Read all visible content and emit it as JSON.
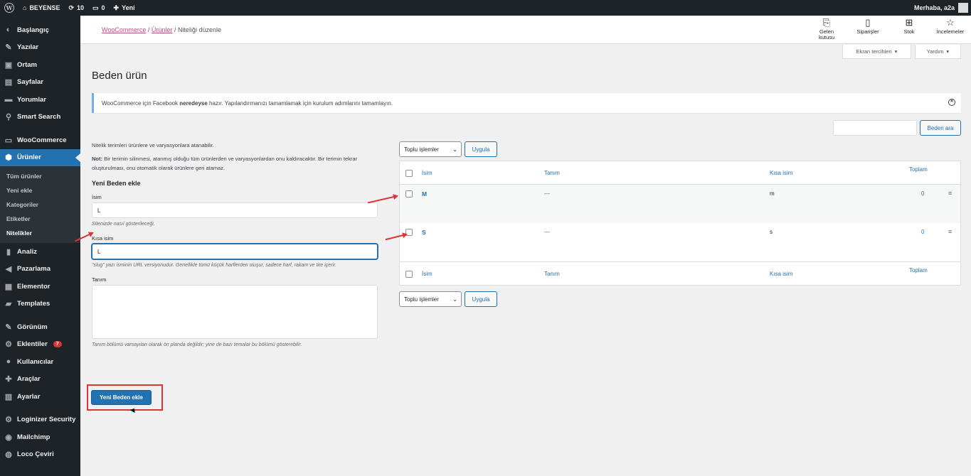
{
  "adminbar": {
    "site_name": "BEYENSE",
    "updates": "10",
    "comments": "0",
    "new_label": "Yeni",
    "greeting": "Merhaba, a2a"
  },
  "sidebar": {
    "items": [
      {
        "label": "Başlangıç",
        "icon": "dashboard-icon",
        "glyph": "◐"
      },
      {
        "label": "Yazılar",
        "icon": "pin-icon",
        "glyph": "✎"
      },
      {
        "label": "Ortam",
        "icon": "media-icon",
        "glyph": "▣"
      },
      {
        "label": "Sayfalar",
        "icon": "pages-icon",
        "glyph": "▤"
      },
      {
        "label": "Yorumlar",
        "icon": "comments-icon",
        "glyph": "▬"
      },
      {
        "label": "Smart Search",
        "icon": "search-icon",
        "glyph": "⚲"
      },
      {
        "label": "WooCommerce",
        "icon": "woocommerce-icon",
        "glyph": "▭"
      },
      {
        "label": "Ürünler",
        "icon": "products-icon",
        "glyph": "⬢"
      },
      {
        "label": "Analiz",
        "icon": "analytics-icon",
        "glyph": "▮"
      },
      {
        "label": "Pazarlama",
        "icon": "megaphone-icon",
        "glyph": "◀"
      },
      {
        "label": "Elementor",
        "icon": "elementor-icon",
        "glyph": "▦"
      },
      {
        "label": "Templates",
        "icon": "folder-icon",
        "glyph": "▰"
      },
      {
        "label": "Görünüm",
        "icon": "brush-icon",
        "glyph": "✎"
      },
      {
        "label": "Eklentiler",
        "icon": "plugin-icon",
        "glyph": "⚙",
        "badge": "7"
      },
      {
        "label": "Kullanıcılar",
        "icon": "users-icon",
        "glyph": "●"
      },
      {
        "label": "Araçlar",
        "icon": "tools-icon",
        "glyph": "✚"
      },
      {
        "label": "Ayarlar",
        "icon": "settings-icon",
        "glyph": "▥"
      },
      {
        "label": "Loginizer Security",
        "icon": "gear-icon",
        "glyph": "⚙"
      },
      {
        "label": "Mailchimp",
        "icon": "mailchimp-icon",
        "glyph": "◉"
      },
      {
        "label": "Loco Çeviri",
        "icon": "translate-icon",
        "glyph": "◍"
      }
    ],
    "submenu": [
      "Tüm ürünler",
      "Yeni ekle",
      "Kategoriler",
      "Etiketler",
      "Nitelikler"
    ]
  },
  "header": {
    "breadcrumb_1": "WooCommerce",
    "breadcrumb_2": "Ürünler",
    "breadcrumb_3": "Niteliği düzenle",
    "tools": [
      {
        "label": "Gelen kutusu",
        "icon": "inbox-icon",
        "glyph": "⎘"
      },
      {
        "label": "Siparişler",
        "icon": "orders-icon",
        "glyph": "▯"
      },
      {
        "label": "Stok",
        "icon": "stock-icon",
        "glyph": "⊞"
      },
      {
        "label": "İncelemeler",
        "icon": "star-icon",
        "glyph": "☆"
      }
    ],
    "screen_options": "Ekran tercihleri",
    "help": "Yardım"
  },
  "page": {
    "title": "Beden ürün",
    "notice_pre": "WooCommerce için Facebook ",
    "notice_bold": "neredeyse",
    "notice_post": " hazır. Yapılandırmanızı tamamlamak için kurulum adımlarını tamamlayın."
  },
  "search": {
    "button": "Beden ara"
  },
  "form": {
    "intro": "Nitelik terimleri ürünlere ve varyasyonlara atanabilir.",
    "note_bold": "Not:",
    "note": " Bir terimin silinmesi, atanmış olduğu tüm ürünlerden ve varyasyonlardan onu kaldıracaktır. Bir terimin tekrar oluşturulması, onu otomatik olarak ürünlere geri atamaz.",
    "heading": "Yeni Beden ekle",
    "name_label": "İsim",
    "name_value": "L",
    "name_help": "Sitenizde nasıl gösterileceği.",
    "slug_label": "Kısa isim",
    "slug_value": "L",
    "slug_help": "\"slug\" yazı isminin URL versiyonudur. Genellikle tümü küçük harflerden oluşur, sadece harf, rakam ve tire içerir.",
    "desc_label": "Tanım",
    "desc_help": "Tanım bölümü varsayılan olarak ön planda değildir; yine de bazı temalar bu bölümü gösterebilir.",
    "submit": "Yeni Beden ekle"
  },
  "table": {
    "bulk_select": "Toplu işlemler",
    "apply": "Uygula",
    "headers": {
      "name": "İsim",
      "desc": "Tanım",
      "slug": "Kısa isim",
      "count": "Toplam"
    },
    "rows": [
      {
        "name": "M",
        "desc": "—",
        "slug": "m",
        "count": "0"
      },
      {
        "name": "S",
        "desc": "—",
        "slug": "s",
        "count": "0"
      }
    ]
  },
  "colors": {
    "accent": "#2271b1",
    "annotation": "#d63638",
    "sidebar_bg": "#1d2327"
  }
}
